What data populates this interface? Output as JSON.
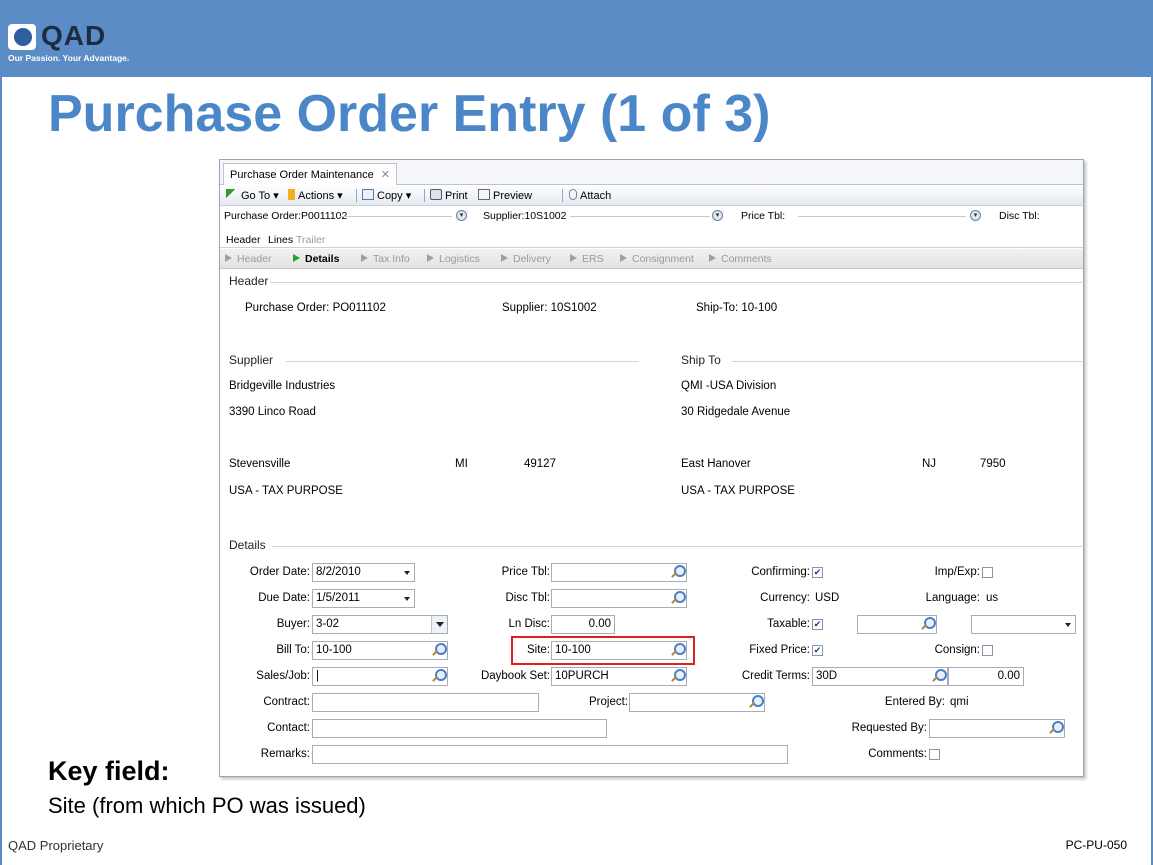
{
  "slide": {
    "logo_text": "QAD",
    "tagline": "Our Passion. Your Advantage.",
    "title": "Purchase Order Entry (1 of 3)",
    "key_field_title": "Key field:",
    "key_field_desc": "Site (from which PO was issued)",
    "footer_left": "QAD Proprietary",
    "footer_right": "PC-PU-050"
  },
  "window": {
    "tab_title": "Purchase Order Maintenance",
    "toolbar": {
      "goto": "Go To",
      "actions": "Actions",
      "copy": "Copy",
      "print": "Print",
      "preview": "Preview",
      "attach": "Attach"
    },
    "key_row": {
      "purchase_order": "Purchase Order:P0011102",
      "supplier": "Supplier:10S1002",
      "price_tbl": "Price Tbl:",
      "disc_tbl": "Disc Tbl:"
    },
    "subtabs": [
      "Header",
      "Lines",
      "Trailer"
    ],
    "steps": [
      "Header",
      "Details",
      "Tax Info",
      "Logistics",
      "Delivery",
      "ERS",
      "Consignment",
      "Comments"
    ],
    "header_section": {
      "label": "Header",
      "purchase_order": "Purchase Order:  PO011102",
      "supplier": "Supplier:  10S1002",
      "ship_to": "Ship-To:  10-100"
    },
    "supplier_section": {
      "label": "Supplier",
      "name": "Bridgeville Industries",
      "address": "3390 Linco Road",
      "city": "Stevensville",
      "state": "MI",
      "zip": "49127",
      "country": "USA - TAX PURPOSE"
    },
    "shipto_section": {
      "label": "Ship To",
      "name": "QMI -USA Division",
      "address": "30 Ridgedale Avenue",
      "city": "East Hanover",
      "state": "NJ",
      "zip": "7950",
      "country": "USA - TAX PURPOSE"
    },
    "details": {
      "label": "Details",
      "order_date_label": "Order Date:",
      "order_date": "8/2/2010",
      "due_date_label": "Due Date:",
      "due_date": "1/5/2011",
      "buyer_label": "Buyer:",
      "buyer": "3-02",
      "bill_to_label": "Bill To:",
      "bill_to": "10-100",
      "sales_job_label": "Sales/Job:",
      "sales_job": "|",
      "contract_label": "Contract:",
      "contract": "",
      "contact_label": "Contact:",
      "contact": "",
      "remarks_label": "Remarks:",
      "remarks": "",
      "price_tbl_label": "Price Tbl:",
      "price_tbl": "",
      "disc_tbl_label": "Disc Tbl:",
      "disc_tbl": "",
      "ln_disc_label": "Ln Disc:",
      "ln_disc": "0.00",
      "site_label": "Site:",
      "site": "10-100",
      "daybook_label": "Daybook Set:",
      "daybook": "10PURCH",
      "project_label": "Project:",
      "project": "",
      "confirming_label": "Confirming:",
      "currency_label": "Currency:",
      "currency": "USD",
      "taxable_label": "Taxable:",
      "taxable_code": "",
      "taxable_select": "",
      "fixed_price_label": "Fixed Price:",
      "credit_terms_label": "Credit Terms:",
      "credit_terms": "30D",
      "credit_amount": "0.00",
      "entered_by_label": "Entered By:",
      "entered_by": "qmi",
      "requested_by_label": "Requested By:",
      "requested_by": "",
      "comments_label": "Comments:",
      "imp_exp_label": "Imp/Exp:",
      "language_label": "Language:",
      "language": "us",
      "consign_label": "Consign:",
      "confirming_checked": "✔",
      "taxable_checked": "✔",
      "fixed_price_checked": "✔"
    }
  },
  "colors": {
    "brand_bar": "#5b8cc6",
    "title_blue": "#4a86c8",
    "highlight_red": "#e02020"
  }
}
